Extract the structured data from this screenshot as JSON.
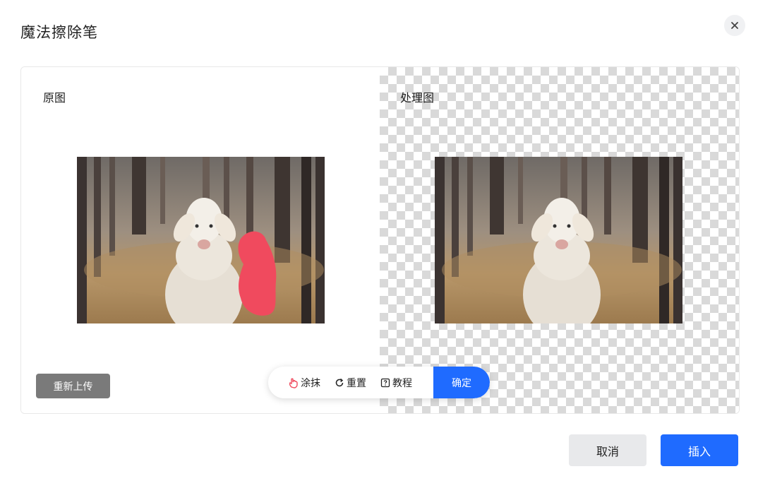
{
  "dialog": {
    "title": "魔法擦除笔",
    "close_icon": "close-icon"
  },
  "original": {
    "label": "原图"
  },
  "processed": {
    "label": "处理图"
  },
  "left_actions": {
    "reupload_label": "重新上传"
  },
  "toolbar": {
    "smear_label": "涂抹",
    "smear_icon": "brush-hand-icon",
    "reset_label": "重置",
    "reset_icon": "refresh-icon",
    "tutorial_label": "教程",
    "tutorial_icon": "help-box-icon",
    "confirm_label": "确定"
  },
  "footer": {
    "cancel_label": "取消",
    "insert_label": "插入"
  },
  "colors": {
    "primary": "#1f6bff",
    "mask": "#f04a5e",
    "gray_button": "#7a7a7a"
  }
}
